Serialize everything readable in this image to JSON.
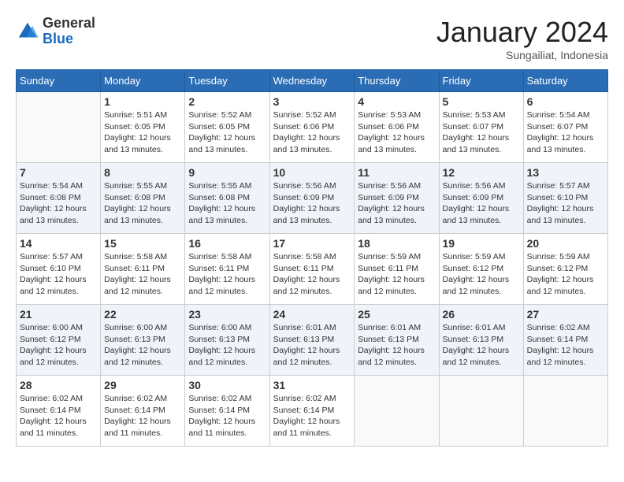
{
  "header": {
    "logo_general": "General",
    "logo_blue": "Blue",
    "month_title": "January 2024",
    "subtitle": "Sungailiat, Indonesia"
  },
  "days_of_week": [
    "Sunday",
    "Monday",
    "Tuesday",
    "Wednesday",
    "Thursday",
    "Friday",
    "Saturday"
  ],
  "weeks": [
    [
      {
        "day": "",
        "info": ""
      },
      {
        "day": "1",
        "info": "Sunrise: 5:51 AM\nSunset: 6:05 PM\nDaylight: 12 hours\nand 13 minutes."
      },
      {
        "day": "2",
        "info": "Sunrise: 5:52 AM\nSunset: 6:05 PM\nDaylight: 12 hours\nand 13 minutes."
      },
      {
        "day": "3",
        "info": "Sunrise: 5:52 AM\nSunset: 6:06 PM\nDaylight: 12 hours\nand 13 minutes."
      },
      {
        "day": "4",
        "info": "Sunrise: 5:53 AM\nSunset: 6:06 PM\nDaylight: 12 hours\nand 13 minutes."
      },
      {
        "day": "5",
        "info": "Sunrise: 5:53 AM\nSunset: 6:07 PM\nDaylight: 12 hours\nand 13 minutes."
      },
      {
        "day": "6",
        "info": "Sunrise: 5:54 AM\nSunset: 6:07 PM\nDaylight: 12 hours\nand 13 minutes."
      }
    ],
    [
      {
        "day": "7",
        "info": "Sunrise: 5:54 AM\nSunset: 6:08 PM\nDaylight: 12 hours\nand 13 minutes."
      },
      {
        "day": "8",
        "info": "Sunrise: 5:55 AM\nSunset: 6:08 PM\nDaylight: 12 hours\nand 13 minutes."
      },
      {
        "day": "9",
        "info": "Sunrise: 5:55 AM\nSunset: 6:08 PM\nDaylight: 12 hours\nand 13 minutes."
      },
      {
        "day": "10",
        "info": "Sunrise: 5:56 AM\nSunset: 6:09 PM\nDaylight: 12 hours\nand 13 minutes."
      },
      {
        "day": "11",
        "info": "Sunrise: 5:56 AM\nSunset: 6:09 PM\nDaylight: 12 hours\nand 13 minutes."
      },
      {
        "day": "12",
        "info": "Sunrise: 5:56 AM\nSunset: 6:09 PM\nDaylight: 12 hours\nand 13 minutes."
      },
      {
        "day": "13",
        "info": "Sunrise: 5:57 AM\nSunset: 6:10 PM\nDaylight: 12 hours\nand 13 minutes."
      }
    ],
    [
      {
        "day": "14",
        "info": "Sunrise: 5:57 AM\nSunset: 6:10 PM\nDaylight: 12 hours\nand 12 minutes."
      },
      {
        "day": "15",
        "info": "Sunrise: 5:58 AM\nSunset: 6:11 PM\nDaylight: 12 hours\nand 12 minutes."
      },
      {
        "day": "16",
        "info": "Sunrise: 5:58 AM\nSunset: 6:11 PM\nDaylight: 12 hours\nand 12 minutes."
      },
      {
        "day": "17",
        "info": "Sunrise: 5:58 AM\nSunset: 6:11 PM\nDaylight: 12 hours\nand 12 minutes."
      },
      {
        "day": "18",
        "info": "Sunrise: 5:59 AM\nSunset: 6:11 PM\nDaylight: 12 hours\nand 12 minutes."
      },
      {
        "day": "19",
        "info": "Sunrise: 5:59 AM\nSunset: 6:12 PM\nDaylight: 12 hours\nand 12 minutes."
      },
      {
        "day": "20",
        "info": "Sunrise: 5:59 AM\nSunset: 6:12 PM\nDaylight: 12 hours\nand 12 minutes."
      }
    ],
    [
      {
        "day": "21",
        "info": "Sunrise: 6:00 AM\nSunset: 6:12 PM\nDaylight: 12 hours\nand 12 minutes."
      },
      {
        "day": "22",
        "info": "Sunrise: 6:00 AM\nSunset: 6:13 PM\nDaylight: 12 hours\nand 12 minutes."
      },
      {
        "day": "23",
        "info": "Sunrise: 6:00 AM\nSunset: 6:13 PM\nDaylight: 12 hours\nand 12 minutes."
      },
      {
        "day": "24",
        "info": "Sunrise: 6:01 AM\nSunset: 6:13 PM\nDaylight: 12 hours\nand 12 minutes."
      },
      {
        "day": "25",
        "info": "Sunrise: 6:01 AM\nSunset: 6:13 PM\nDaylight: 12 hours\nand 12 minutes."
      },
      {
        "day": "26",
        "info": "Sunrise: 6:01 AM\nSunset: 6:13 PM\nDaylight: 12 hours\nand 12 minutes."
      },
      {
        "day": "27",
        "info": "Sunrise: 6:02 AM\nSunset: 6:14 PM\nDaylight: 12 hours\nand 12 minutes."
      }
    ],
    [
      {
        "day": "28",
        "info": "Sunrise: 6:02 AM\nSunset: 6:14 PM\nDaylight: 12 hours\nand 11 minutes."
      },
      {
        "day": "29",
        "info": "Sunrise: 6:02 AM\nSunset: 6:14 PM\nDaylight: 12 hours\nand 11 minutes."
      },
      {
        "day": "30",
        "info": "Sunrise: 6:02 AM\nSunset: 6:14 PM\nDaylight: 12 hours\nand 11 minutes."
      },
      {
        "day": "31",
        "info": "Sunrise: 6:02 AM\nSunset: 6:14 PM\nDaylight: 12 hours\nand 11 minutes."
      },
      {
        "day": "",
        "info": ""
      },
      {
        "day": "",
        "info": ""
      },
      {
        "day": "",
        "info": ""
      }
    ]
  ]
}
